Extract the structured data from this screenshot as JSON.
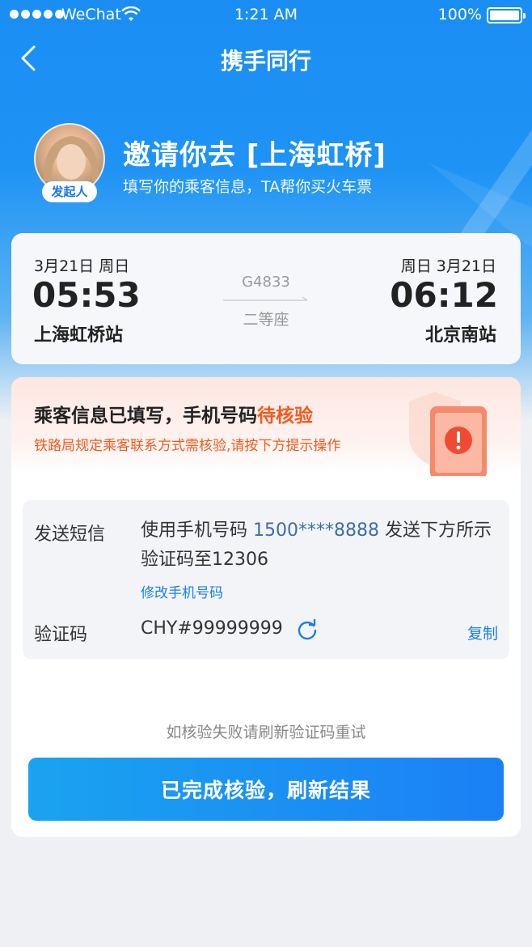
{
  "status_bar": {
    "carrier": "WeChat",
    "time": "1:21 AM",
    "battery": "100%"
  },
  "nav": {
    "title": "携手同行",
    "back_icon": "chevron-left-icon"
  },
  "invite": {
    "badge": "发起人",
    "title": "邀请你去 [上海虹桥]",
    "subtitle": "填写你的乘客信息，TA帮你买火车票"
  },
  "trip": {
    "departure": {
      "date": "3月21日 周日",
      "time": "05:53",
      "station": "上海虹桥站"
    },
    "arrival": {
      "date": "周日 3月21日",
      "time": "06:12",
      "station": "北京南站"
    },
    "train_no": "G4833",
    "seat_class": "二等座"
  },
  "alert": {
    "title_prefix": "乘客信息已填写，手机号码",
    "title_highlight": "待核验",
    "subtitle": "铁路局规定乘客联系方式需核验,请按下方提示操作",
    "accent_color": "#f25a1f"
  },
  "verification": {
    "sms_label": "发送短信",
    "sms_text_before": "使用手机号码 ",
    "phone": "1500****8888",
    "sms_text_after": " 发送下方所示验证码至12306",
    "modify_link": "修改手机号码",
    "code_label": "验证码",
    "code_value": "CHY#99999999",
    "copy_label": "复制"
  },
  "footer": {
    "hint": "如核验失败请刷新验证码重试",
    "button_label": "已完成核验，刷新结果"
  }
}
